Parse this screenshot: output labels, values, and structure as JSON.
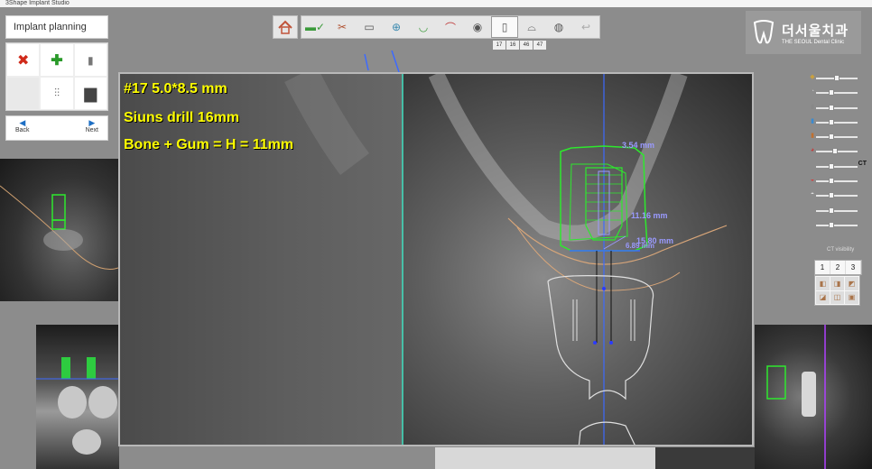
{
  "app": {
    "title": "3Shape Implant Studio"
  },
  "panel": {
    "title": "Implant planning",
    "tools": [
      {
        "icon": "delete-icon",
        "glyph": "✖",
        "color": "#d02a1a"
      },
      {
        "icon": "add-icon",
        "glyph": "✚",
        "color": "#2a9a2a"
      },
      {
        "icon": "implant-icon",
        "glyph": "▯",
        "color": "#555"
      },
      {
        "icon": "empty",
        "glyph": "",
        "color": "#555"
      },
      {
        "icon": "abutment-icon",
        "glyph": "⋓",
        "color": "#555"
      },
      {
        "icon": "sleeve-icon",
        "glyph": "▆",
        "color": "#444"
      }
    ],
    "back_label": "Back",
    "next_label": "Next"
  },
  "tooth_numbers": [
    "17",
    "16",
    "46",
    "47"
  ],
  "logo": {
    "ko": "더서울치과",
    "en": "THE SEOUL Dental Clinic"
  },
  "annotations": {
    "line1": "#17 5.0*8.5 mm",
    "line2": "Siuns drill 16mm",
    "line3": "Bone + Gum = H = 11mm"
  },
  "measurements": {
    "width": "3.54 mm",
    "height": "11.16 mm",
    "length": "15.80 mm",
    "depth": "6.89 mm"
  },
  "right_controls": {
    "sliders": [
      {
        "icon": "crown-icon",
        "level": 0.5,
        "tag": ""
      },
      {
        "icon": "tooth-icon",
        "level": 0.35,
        "tag": ""
      },
      {
        "icon": "implant-icon",
        "level": 0.35,
        "tag": ""
      },
      {
        "icon": "drill-icon",
        "level": 0.35,
        "tag": ""
      },
      {
        "icon": "sleeve-icon",
        "level": 0.35,
        "tag": ""
      },
      {
        "icon": "nerve-icon",
        "level": 0.45,
        "tag": ""
      },
      {
        "icon": "ct-icon",
        "level": 0.35,
        "tag": "CT"
      },
      {
        "icon": "bone-icon",
        "level": 0.35,
        "tag": ""
      },
      {
        "icon": "gum-icon",
        "level": 0.35,
        "tag": ""
      },
      {
        "icon": "brightness-icon",
        "level": 0.35,
        "tag": ""
      },
      {
        "icon": "contrast-icon",
        "level": 0.35,
        "tag": ""
      }
    ],
    "ct_visibility_label": "CT visibility",
    "pages": [
      "1",
      "2",
      "3"
    ]
  },
  "colors": {
    "implant_outline": "#2ee82e",
    "measurement": "#9a9aff",
    "annotation": "#ffff00",
    "nerve": "#d9a679"
  }
}
